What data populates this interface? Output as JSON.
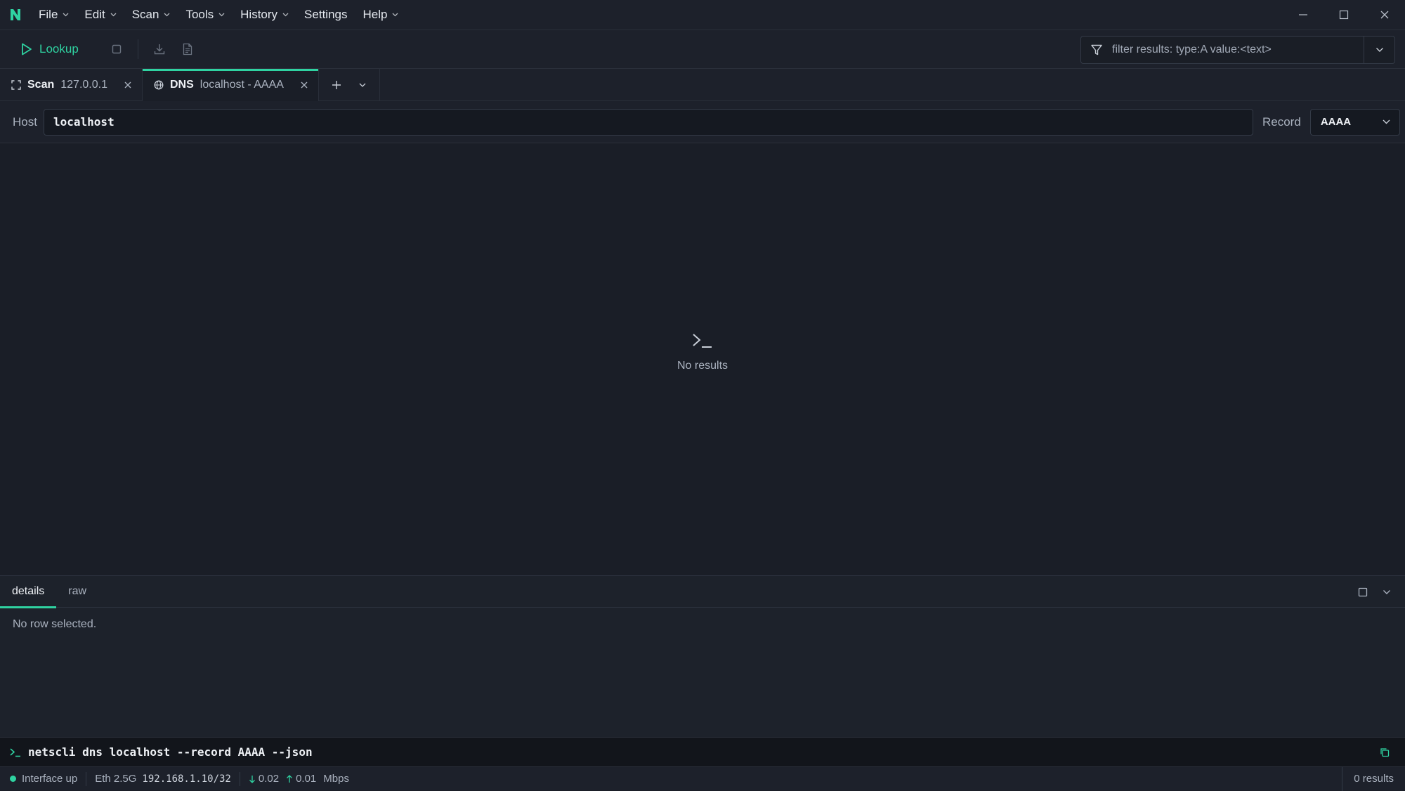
{
  "app": {
    "logo_letter": "N",
    "menus": [
      {
        "label": "File",
        "has_dropdown": true
      },
      {
        "label": "Edit",
        "has_dropdown": true
      },
      {
        "label": "Scan",
        "has_dropdown": true
      },
      {
        "label": "Tools",
        "has_dropdown": true
      },
      {
        "label": "History",
        "has_dropdown": true
      },
      {
        "label": "Settings",
        "has_dropdown": false
      },
      {
        "label": "Help",
        "has_dropdown": true
      }
    ]
  },
  "toolbar": {
    "lookup_label": "Lookup",
    "filter_placeholder": "filter results: type:A value:<text>"
  },
  "tabs": [
    {
      "kind": "Scan",
      "description": "127.0.0.1",
      "active": false,
      "icon": "scan-icon"
    },
    {
      "kind": "DNS",
      "description": "localhost - AAAA",
      "active": true,
      "icon": "globe-icon"
    }
  ],
  "query": {
    "host_label": "Host",
    "host_value": "localhost",
    "record_label": "Record",
    "record_value": "AAAA"
  },
  "results": {
    "empty_text": "No results",
    "icon": "terminal-icon"
  },
  "details": {
    "tabs": [
      {
        "label": "details",
        "active": true
      },
      {
        "label": "raw",
        "active": false
      }
    ],
    "empty_text": "No row selected."
  },
  "command": {
    "text": "netscli dns localhost --record AAAA --json"
  },
  "status": {
    "interface_status": "Interface up",
    "interface_name": "Eth 2.5G",
    "ip_address": "192.168.1.10/32",
    "down_rate": "0.02",
    "up_rate": "0.01",
    "rate_unit": "Mbps",
    "results_count": "0 results"
  },
  "colors": {
    "accent": "#2fd2a1",
    "background": "#1a1e27",
    "panel": "#1d212b",
    "command_bg": "#12151b"
  }
}
